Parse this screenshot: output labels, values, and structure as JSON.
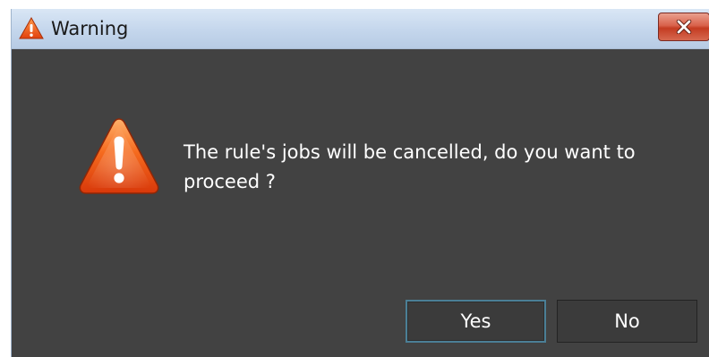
{
  "dialog": {
    "title": "Warning",
    "message": "The rule's jobs will be cancelled, do you want to proceed ?",
    "yes_label": "Yes",
    "no_label": "No"
  },
  "icons": {
    "title": "warning-icon",
    "close": "close-icon",
    "message": "warning-icon"
  },
  "colors": {
    "dialog_background": "#424242",
    "titlebar": "#c4d6ec",
    "close_button": "#d9624b",
    "warning_orange": "#f06a1c",
    "focus_border": "#4b7f96"
  }
}
